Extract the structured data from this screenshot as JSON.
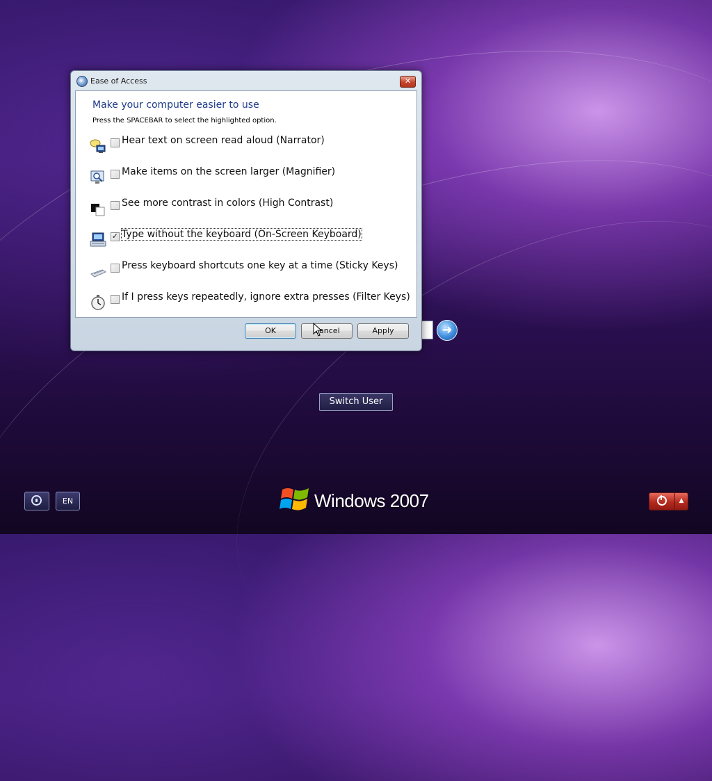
{
  "dialog": {
    "title": "Ease of Access",
    "close_glyph": "✕",
    "heading": "Make your computer easier to use",
    "subheading": "Press the SPACEBAR to select the highlighted option.",
    "options": [
      {
        "label": "Hear text on screen read aloud (Narrator)",
        "checked": false,
        "icon": "narrator-icon"
      },
      {
        "label": "Make items on the screen larger (Magnifier)",
        "checked": false,
        "icon": "magnifier-icon"
      },
      {
        "label": "See more contrast in colors (High Contrast)",
        "checked": false,
        "icon": "high-contrast-icon"
      },
      {
        "label": "Type without the keyboard (On-Screen Keyboard)",
        "checked": true,
        "icon": "on-screen-keyboard-icon"
      },
      {
        "label": "Press keyboard shortcuts one key at a time (Sticky Keys)",
        "checked": false,
        "icon": "sticky-keys-icon"
      },
      {
        "label": "If I press keys repeatedly, ignore extra presses (Filter Keys)",
        "checked": false,
        "icon": "filter-keys-icon"
      }
    ],
    "check_glyph": "✓",
    "buttons": {
      "ok": "OK",
      "cancel": "Cancel",
      "apply": "Apply"
    }
  },
  "login": {
    "go_glyph": "➜",
    "switch_user": "Switch User"
  },
  "bottom_bar": {
    "language": "EN",
    "brand": "Windows 2007",
    "power_menu_glyph": "▲"
  },
  "colors": {
    "heading": "#1e3b8a",
    "power": "#b32a1e",
    "accent": "#3d8ddd"
  }
}
